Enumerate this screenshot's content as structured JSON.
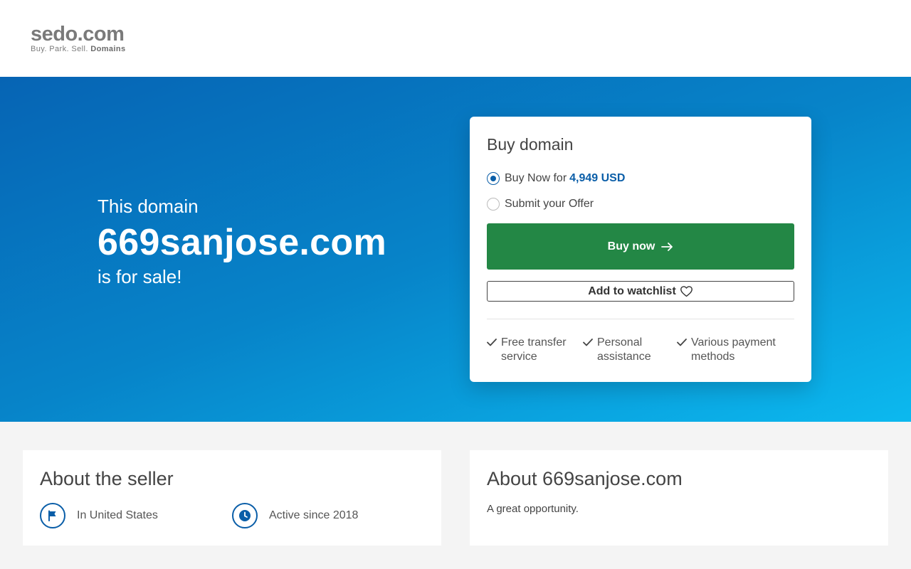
{
  "header": {
    "logo_main": "sedo.com",
    "logo_tag": "Buy.  Park.  Sell.",
    "logo_tag_bold": "Domains"
  },
  "hero": {
    "line1": "This domain",
    "domain": "669sanjose.com",
    "line3": "is for sale!"
  },
  "buy_card": {
    "title": "Buy domain",
    "option_buy_now_label": "Buy Now for",
    "option_buy_now_price": "4,949 USD",
    "option_offer_label": "Submit your Offer",
    "buy_button_label": "Buy now",
    "watchlist_button_label": "Add to watchlist",
    "features": [
      "Free transfer service",
      "Personal assistance",
      "Various payment methods"
    ]
  },
  "seller": {
    "title": "About the seller",
    "location": "In United States",
    "active_since": "Active since 2018"
  },
  "about_domain": {
    "title": "About 669sanjose.com",
    "description": "A great opportunity."
  },
  "colors": {
    "accent_blue": "#0a5ea8",
    "buy_green": "#238745",
    "hero_gradient_start": "#0664b4",
    "hero_gradient_end": "#0cb9ef"
  }
}
